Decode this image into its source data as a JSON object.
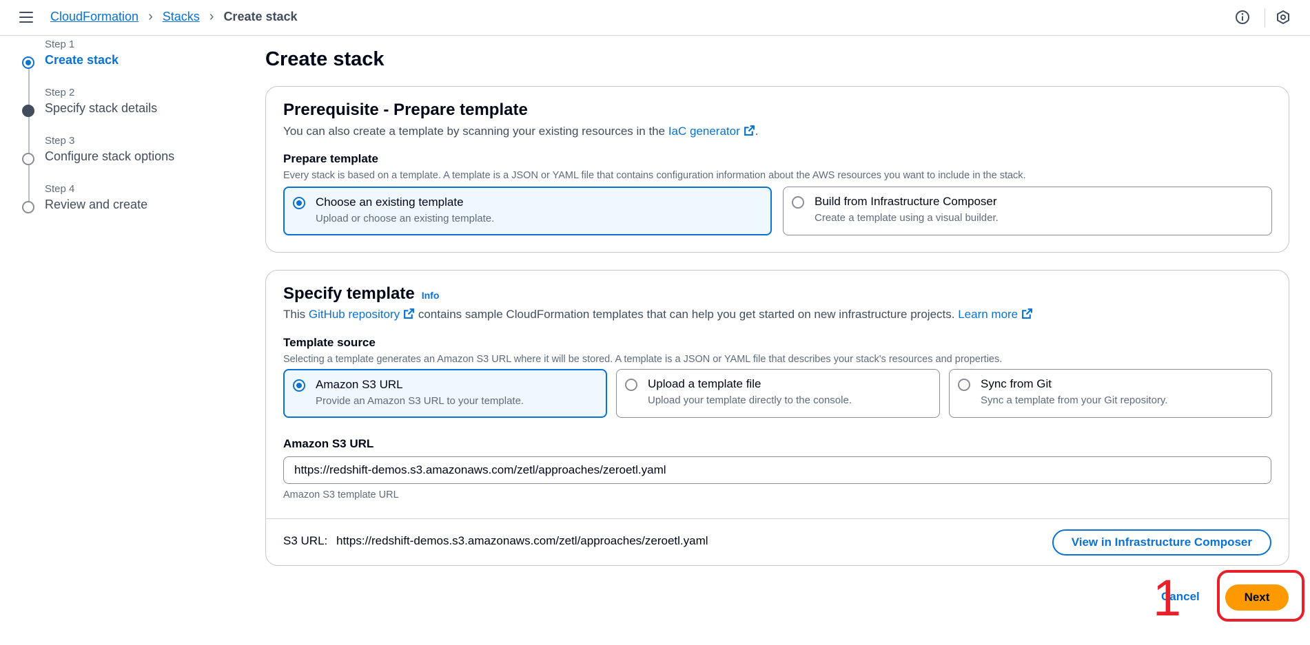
{
  "breadcrumb": {
    "items": [
      "CloudFormation",
      "Stacks"
    ],
    "current": "Create stack"
  },
  "steps": [
    {
      "num": "Step 1",
      "title": "Create stack",
      "state": "active"
    },
    {
      "num": "Step 2",
      "title": "Specify stack details",
      "state": "filled"
    },
    {
      "num": "Step 3",
      "title": "Configure stack options",
      "state": "empty"
    },
    {
      "num": "Step 4",
      "title": "Review and create",
      "state": "empty"
    }
  ],
  "page_title": "Create stack",
  "prerequisite": {
    "heading": "Prerequisite - Prepare template",
    "desc_prefix": "You can also create a template by scanning your existing resources in the ",
    "desc_link": "IaC generator",
    "desc_suffix": ".",
    "label": "Prepare template",
    "hint": "Every stack is based on a template. A template is a JSON or YAML file that contains configuration information about the AWS resources you want to include in the stack.",
    "options": [
      {
        "title": "Choose an existing template",
        "desc": "Upload or choose an existing template.",
        "selected": true
      },
      {
        "title": "Build from Infrastructure Composer",
        "desc": "Create a template using a visual builder.",
        "selected": false
      }
    ]
  },
  "specify": {
    "heading": "Specify template",
    "info": "Info",
    "desc_prefix": "This ",
    "desc_link": "GitHub repository",
    "desc_mid": " contains sample CloudFormation templates that can help you get started on new infrastructure projects. ",
    "desc_link2": "Learn more",
    "label": "Template source",
    "hint": "Selecting a template generates an Amazon S3 URL where it will be stored. A template is a JSON or YAML file that describes your stack's resources and properties.",
    "options": [
      {
        "title": "Amazon S3 URL",
        "desc": "Provide an Amazon S3 URL to your template.",
        "selected": true
      },
      {
        "title": "Upload a template file",
        "desc": "Upload your template directly to the console.",
        "selected": false
      },
      {
        "title": "Sync from Git",
        "desc": "Sync a template from your Git repository.",
        "selected": false
      }
    ],
    "url_label": "Amazon S3 URL",
    "url_value": "https://redshift-demos.s3.amazonaws.com/zetl/approaches/zeroetl.yaml",
    "url_hint": "Amazon S3 template URL",
    "footer_label": "S3 URL:",
    "footer_value": "https://redshift-demos.s3.amazonaws.com/zetl/approaches/zeroetl.yaml",
    "view_button": "View in Infrastructure Composer"
  },
  "actions": {
    "cancel": "Cancel",
    "next": "Next"
  },
  "annotation": {
    "number": "1",
    "color": "#e8202a"
  },
  "colors": {
    "accent": "#0972d3",
    "primary_button": "#ff9900"
  },
  "icons": [
    "menu-icon",
    "info-circle-icon",
    "settings-hex-icon",
    "external-link-icon"
  ]
}
